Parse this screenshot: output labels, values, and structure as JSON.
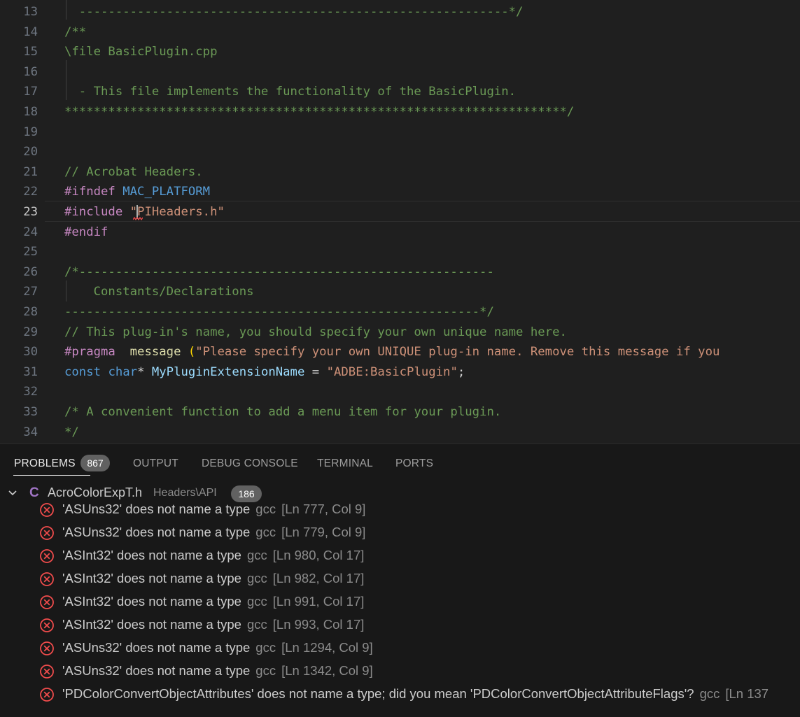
{
  "editor": {
    "lines": [
      {
        "num": "13",
        "tokens": [
          {
            "t": "  -----------------------------------------------------------*/",
            "c": "c-com"
          }
        ]
      },
      {
        "num": "14",
        "tokens": [
          {
            "t": "/**",
            "c": "c-com"
          }
        ]
      },
      {
        "num": "15",
        "tokens": [
          {
            "t": "\\file BasicPlugin.cpp",
            "c": "c-com"
          }
        ]
      },
      {
        "num": "16",
        "tokens": []
      },
      {
        "num": "17",
        "tokens": [
          {
            "t": "  - This file implements the functionality of the BasicPlugin.",
            "c": "c-com"
          }
        ]
      },
      {
        "num": "18",
        "tokens": [
          {
            "t": "*********************************************************************/",
            "c": "c-com"
          }
        ]
      },
      {
        "num": "19",
        "tokens": []
      },
      {
        "num": "20",
        "tokens": []
      },
      {
        "num": "21",
        "tokens": [
          {
            "t": "// Acrobat Headers.",
            "c": "c-com"
          }
        ]
      },
      {
        "num": "22",
        "tokens": [
          {
            "t": "#ifndef ",
            "c": "c-pp"
          },
          {
            "t": "MAC_PLATFORM",
            "c": "c-mac"
          }
        ]
      },
      {
        "num": "23",
        "tokens": [
          {
            "t": "#include ",
            "c": "c-pp"
          },
          {
            "t": "\"",
            "c": "c-str"
          },
          {
            "t": "|caret|",
            "c": "caret"
          },
          {
            "t": "PIHeaders.h\"",
            "c": "c-str"
          }
        ]
      },
      {
        "num": "24",
        "tokens": [
          {
            "t": "#endif",
            "c": "c-pp"
          }
        ]
      },
      {
        "num": "25",
        "tokens": []
      },
      {
        "num": "26",
        "tokens": [
          {
            "t": "/*---------------------------------------------------------",
            "c": "c-com"
          }
        ]
      },
      {
        "num": "27",
        "tokens": [
          {
            "t": "    Constants/Declarations",
            "c": "c-com"
          }
        ]
      },
      {
        "num": "28",
        "tokens": [
          {
            "t": "---------------------------------------------------------*/",
            "c": "c-com"
          }
        ]
      },
      {
        "num": "29",
        "tokens": [
          {
            "t": "// This plug-in's name, you should specify your own unique name here.",
            "c": "c-com"
          }
        ]
      },
      {
        "num": "30",
        "tokens": [
          {
            "t": "#pragma ",
            "c": "c-pp"
          },
          {
            "t": " message ",
            "c": "c-fn"
          },
          {
            "t": "(",
            "c": "c-par"
          },
          {
            "t": "\"Please specify your own UNIQUE plug-in name. Remove this message if you",
            "c": "c-str"
          }
        ]
      },
      {
        "num": "31",
        "tokens": [
          {
            "t": "const ",
            "c": "c-kw"
          },
          {
            "t": "char",
            "c": "c-kw"
          },
          {
            "t": "* ",
            "c": "c-pl"
          },
          {
            "t": "MyPluginExtensionName",
            "c": "c-var"
          },
          {
            "t": " = ",
            "c": "c-pl"
          },
          {
            "t": "\"ADBE:BasicPlugin\"",
            "c": "c-str"
          },
          {
            "t": ";",
            "c": "c-pl"
          }
        ]
      },
      {
        "num": "32",
        "tokens": []
      },
      {
        "num": "33",
        "tokens": [
          {
            "t": "/* A convenient function to add a menu item for your plugin.",
            "c": "c-com"
          }
        ]
      },
      {
        "num": "34",
        "tokens": [
          {
            "t": "*/",
            "c": "c-com"
          }
        ]
      }
    ],
    "current_line": "23"
  },
  "panel": {
    "tabs": [
      {
        "label": "PROBLEMS",
        "badge": "867",
        "active": true
      },
      {
        "label": "OUTPUT"
      },
      {
        "label": "DEBUG CONSOLE"
      },
      {
        "label": "TERMINAL"
      },
      {
        "label": "PORTS"
      }
    ],
    "file": {
      "icon": "C",
      "name": "AcroColorExpT.h",
      "path": "Headers\\API",
      "count": "186"
    },
    "problems": [
      {
        "msg": "'ASUns32' does not name a type",
        "src": "gcc",
        "pos": "[Ln 777, Col 9]"
      },
      {
        "msg": "'ASUns32' does not name a type",
        "src": "gcc",
        "pos": "[Ln 779, Col 9]"
      },
      {
        "msg": "'ASInt32' does not name a type",
        "src": "gcc",
        "pos": "[Ln 980, Col 17]"
      },
      {
        "msg": "'ASInt32' does not name a type",
        "src": "gcc",
        "pos": "[Ln 982, Col 17]"
      },
      {
        "msg": "'ASInt32' does not name a type",
        "src": "gcc",
        "pos": "[Ln 991, Col 17]"
      },
      {
        "msg": "'ASInt32' does not name a type",
        "src": "gcc",
        "pos": "[Ln 993, Col 17]"
      },
      {
        "msg": "'ASUns32' does not name a type",
        "src": "gcc",
        "pos": "[Ln 1294, Col 9]"
      },
      {
        "msg": "'ASUns32' does not name a type",
        "src": "gcc",
        "pos": "[Ln 1342, Col 9]"
      },
      {
        "msg": "'PDColorConvertObjectAttributes' does not name a type; did you mean 'PDColorConvertObjectAttributeFlags'?",
        "src": "gcc",
        "pos": "[Ln 137"
      }
    ]
  },
  "colors": {
    "editor_bg": "#1f1f1f",
    "panel_bg": "#181818",
    "comment": "#6a9955",
    "preprocessor": "#c586c0",
    "string": "#ce9178",
    "error": "#f14c4c"
  }
}
